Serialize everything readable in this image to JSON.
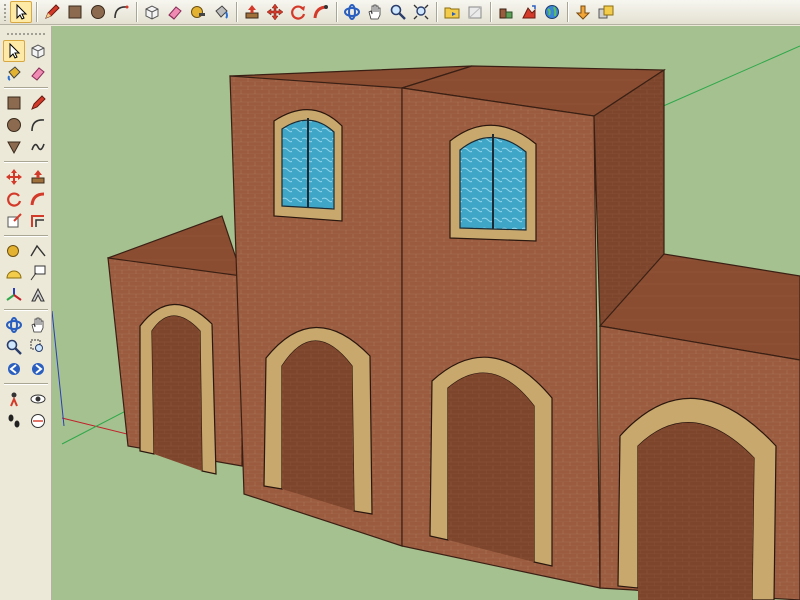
{
  "top_toolbar": {
    "tools": [
      {
        "name": "select-tool-button",
        "icon": "arrow-cursor-icon",
        "active": true
      },
      {
        "name": "pencil-tool-button",
        "icon": "pencil-icon"
      },
      {
        "name": "rectangle-tool-button",
        "icon": "rectangle-icon"
      },
      {
        "name": "circle-tool-button",
        "icon": "circle-icon"
      },
      {
        "name": "arc-tool-button",
        "icon": "arc-icon"
      },
      {
        "name": "make-component-button",
        "icon": "component-icon"
      },
      {
        "name": "eraser-tool-button",
        "icon": "eraser-icon"
      },
      {
        "name": "tape-measure-button",
        "icon": "tape-measure-icon"
      },
      {
        "name": "paint-bucket-button",
        "icon": "paint-bucket-icon"
      },
      {
        "name": "push-pull-button",
        "icon": "push-pull-icon"
      },
      {
        "name": "move-tool-button",
        "icon": "move-icon"
      },
      {
        "name": "rotate-tool-button",
        "icon": "rotate-icon"
      },
      {
        "name": "follow-me-button",
        "icon": "follow-me-icon"
      },
      {
        "name": "orbit-tool-button",
        "icon": "orbit-icon"
      },
      {
        "name": "pan-tool-button",
        "icon": "hand-icon"
      },
      {
        "name": "zoom-tool-button",
        "icon": "magnifier-icon"
      },
      {
        "name": "zoom-extents-button",
        "icon": "zoom-extents-icon"
      },
      {
        "name": "previous-view-button",
        "icon": "folder-icon"
      },
      {
        "name": "next-view-button",
        "icon": "next-view-icon"
      },
      {
        "name": "add-location-button",
        "icon": "add-location-icon"
      },
      {
        "name": "toggle-terrain-button",
        "icon": "terrain-icon"
      },
      {
        "name": "get-models-button",
        "icon": "globe-icon"
      },
      {
        "name": "share-model-button",
        "icon": "share-model-icon"
      },
      {
        "name": "share-component-button",
        "icon": "share-component-icon"
      }
    ]
  },
  "left_toolbar": {
    "rows": [
      [
        "select-icon",
        "make-component-icon"
      ],
      [
        "paint-bucket-icon",
        "eraser-icon"
      ],
      [
        "rectangle-icon",
        "line-icon"
      ],
      [
        "circle-icon",
        "arc-icon"
      ],
      [
        "polygon-icon",
        "freehand-icon"
      ],
      [
        "move-icon",
        "push-pull-icon"
      ],
      [
        "rotate-icon",
        "follow-me-icon"
      ],
      [
        "scale-icon",
        "offset-icon"
      ],
      [
        "tape-measure-icon",
        "dimension-icon"
      ],
      [
        "protractor-icon",
        "text-icon"
      ],
      [
        "axes-icon",
        "3d-text-icon"
      ],
      [
        "orbit-icon",
        "pan-icon"
      ],
      [
        "zoom-icon",
        "zoom-window-icon"
      ],
      [
        "previous-icon",
        "zoom-extents-icon"
      ],
      [
        "position-camera-icon",
        "look-around-icon"
      ],
      [
        "walk-icon",
        "section-plane-icon"
      ]
    ]
  },
  "viewport": {
    "colors": {
      "background": "#a6c190",
      "brick_front": "#9b5b3e",
      "brick_side": "#7d452c",
      "roof": "#8a4d32",
      "arch_trim": "#c9a86e",
      "window_glass": "#3fa6c7",
      "axis_red": "#c0202a",
      "axis_green": "#2da84a",
      "axis_blue": "#2a3db8"
    }
  }
}
